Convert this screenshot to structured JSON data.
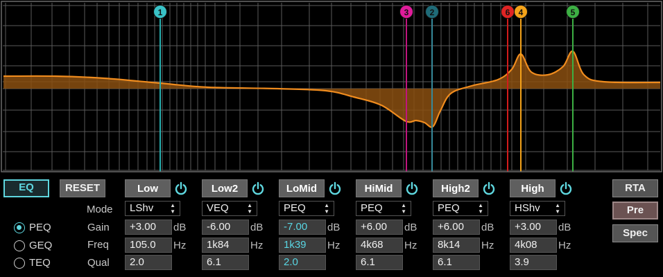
{
  "graph": {
    "background": "#000000",
    "grid_color": "#5a5a5a",
    "curve_color": "#f08c1e",
    "fill_color": "#8a4f10",
    "markers": [
      {
        "label": "1",
        "color": "#39c2c7",
        "line_color": "#28b0b0"
      },
      {
        "label": "3",
        "color": "#e01c9a",
        "line_color": "#c0157e"
      },
      {
        "label": "2",
        "color": "#1f6b78",
        "line_color": "#36899a"
      },
      {
        "label": "6",
        "color": "#e02424",
        "line_color": "#d21b1b"
      },
      {
        "label": "4",
        "color": "#f5a31a",
        "line_color": "#f5a31a"
      },
      {
        "label": "5",
        "color": "#3cb043",
        "line_color": "#3cb043"
      }
    ]
  },
  "left": {
    "eq_label": "EQ",
    "reset_label": "RESET",
    "modes": [
      "PEQ",
      "GEQ",
      "TEQ"
    ],
    "selected_mode": "PEQ"
  },
  "row_labels": {
    "mode": "Mode",
    "gain": "Gain",
    "freq": "Freq",
    "qual": "Qual"
  },
  "bands": [
    {
      "name": "Low",
      "mode": "LShv",
      "gain": "+3.00",
      "gain_unit": "dB",
      "freq": "105.0",
      "freq_unit": "Hz",
      "q": "2.0",
      "active": false
    },
    {
      "name": "Low2",
      "mode": "VEQ",
      "gain": "-6.00",
      "gain_unit": "dB",
      "freq": "1k84",
      "freq_unit": "Hz",
      "q": "6.1",
      "active": false
    },
    {
      "name": "LoMid",
      "mode": "PEQ",
      "gain": "-7.00",
      "gain_unit": "dB",
      "freq": "1k39",
      "freq_unit": "Hz",
      "q": "2.0",
      "active": true
    },
    {
      "name": "HiMid",
      "mode": "PEQ",
      "gain": "+6.00",
      "gain_unit": "dB",
      "freq": "4k68",
      "freq_unit": "Hz",
      "q": "6.1",
      "active": false
    },
    {
      "name": "High2",
      "mode": "PEQ",
      "gain": "+6.00",
      "gain_unit": "dB",
      "freq": "8k14",
      "freq_unit": "Hz",
      "q": "6.1",
      "active": false
    },
    {
      "name": "High",
      "mode": "HShv",
      "gain": "+3.00",
      "gain_unit": "dB",
      "freq": "4k08",
      "freq_unit": "Hz",
      "q": "3.9",
      "active": false
    }
  ],
  "right": {
    "rta_label": "RTA",
    "pre_label": "Pre",
    "spec_label": "Spec"
  },
  "accent_color": "#5fd8e0"
}
